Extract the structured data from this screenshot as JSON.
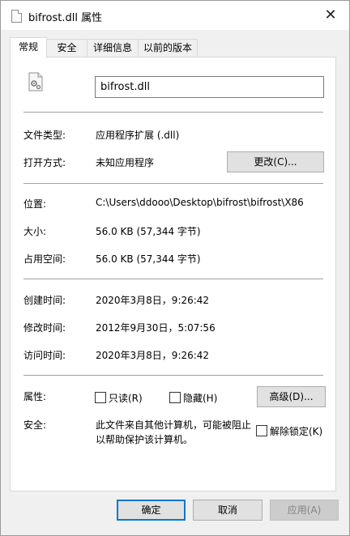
{
  "window": {
    "title": "bifrost.dll 属性",
    "close_glyph": "✕"
  },
  "tabs": [
    {
      "label": "常规",
      "active": true
    },
    {
      "label": "安全",
      "active": false
    },
    {
      "label": "详细信息",
      "active": false
    },
    {
      "label": "以前的版本",
      "active": false
    }
  ],
  "general": {
    "file_icon": "settings-file-icon",
    "filename": "bifrost.dll",
    "file_type_label": "文件类型:",
    "file_type_value": "应用程序扩展 (.dll)",
    "opens_with_label": "打开方式:",
    "opens_with_value": "未知应用程序",
    "change_button": "更改(C)...",
    "location_label": "位置:",
    "location_value": "C:\\Users\\ddooo\\Desktop\\bifrost\\bifrost\\X86",
    "size_label": "大小:",
    "size_value": "56.0 KB (57,344 字节)",
    "size_on_disk_label": "占用空间:",
    "size_on_disk_value": "56.0 KB (57,344 字节)",
    "created_label": "创建时间:",
    "created_value": "2020年3月8日，9:26:42",
    "modified_label": "修改时间:",
    "modified_value": "2012年9月30日，5:07:56",
    "accessed_label": "访问时间:",
    "accessed_value": "2020年3月8日，9:26:42",
    "attributes_label": "属性:",
    "readonly_label": "只读(R)",
    "readonly_checked": false,
    "hidden_label": "隐藏(H)",
    "hidden_checked": false,
    "advanced_button": "高级(D)...",
    "security_label": "安全:",
    "security_text": "此文件来自其他计算机，可能被阻止以帮助保护该计算机。",
    "unblock_label": "解除锁定(K)",
    "unblock_checked": false
  },
  "footer": {
    "ok": "确定",
    "cancel": "取消",
    "apply": "应用(A)"
  },
  "colors": {
    "accent": "#0078d7",
    "panel": "#ffffff",
    "dialog": "#f0f0f0"
  }
}
